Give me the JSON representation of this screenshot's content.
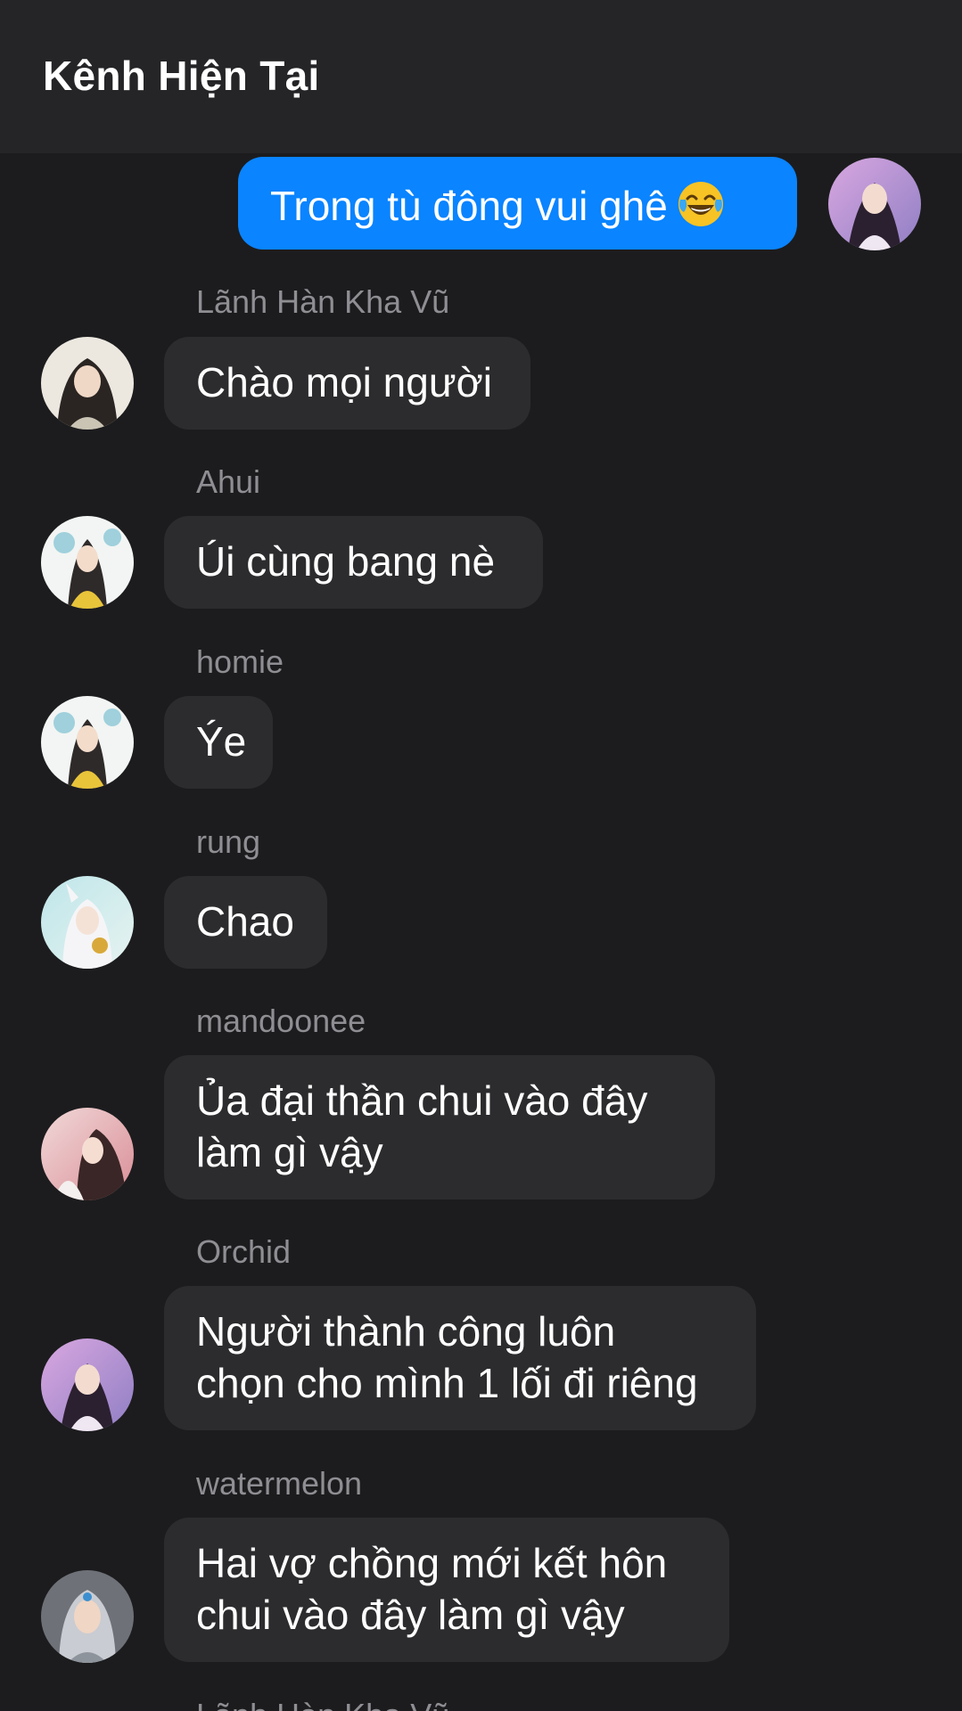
{
  "header": {
    "title": "Kênh Hiện Tại"
  },
  "messages": [
    {
      "sender": "",
      "text": "Trong tù đông vui ghê",
      "emoji": "face-with-tears-of-joy-emoji",
      "outgoing": true
    },
    {
      "sender": "Lãnh Hàn Kha Vũ",
      "lines": [
        "Chào mọi người"
      ]
    },
    {
      "sender": "Ahui",
      "lines": [
        "Úi cùng bang nè"
      ]
    },
    {
      "sender": "homie",
      "lines": [
        "Ýe"
      ]
    },
    {
      "sender": "rung",
      "lines": [
        "Chao"
      ]
    },
    {
      "sender": "mandoonee",
      "lines": [
        "Ủa đại thần chui vào đây",
        "làm gì vậy"
      ]
    },
    {
      "sender": "Orchid",
      "lines": [
        "Người thành công luôn",
        "chọn cho mình 1 lối đi riêng"
      ]
    },
    {
      "sender": "watermelon",
      "lines": [
        "Hai vợ chồng mới kết hôn",
        "chui vào đây làm gì vậy"
      ]
    },
    {
      "sender": "Lãnh Hàn Kha Vũ",
      "lines": []
    }
  ],
  "colors": {
    "background": "#1c1c1e",
    "header": "#252527",
    "incoming_bubble": "#2c2c2e",
    "outgoing_bubble": "#0a84ff",
    "sender_name": "#8e8e93"
  }
}
